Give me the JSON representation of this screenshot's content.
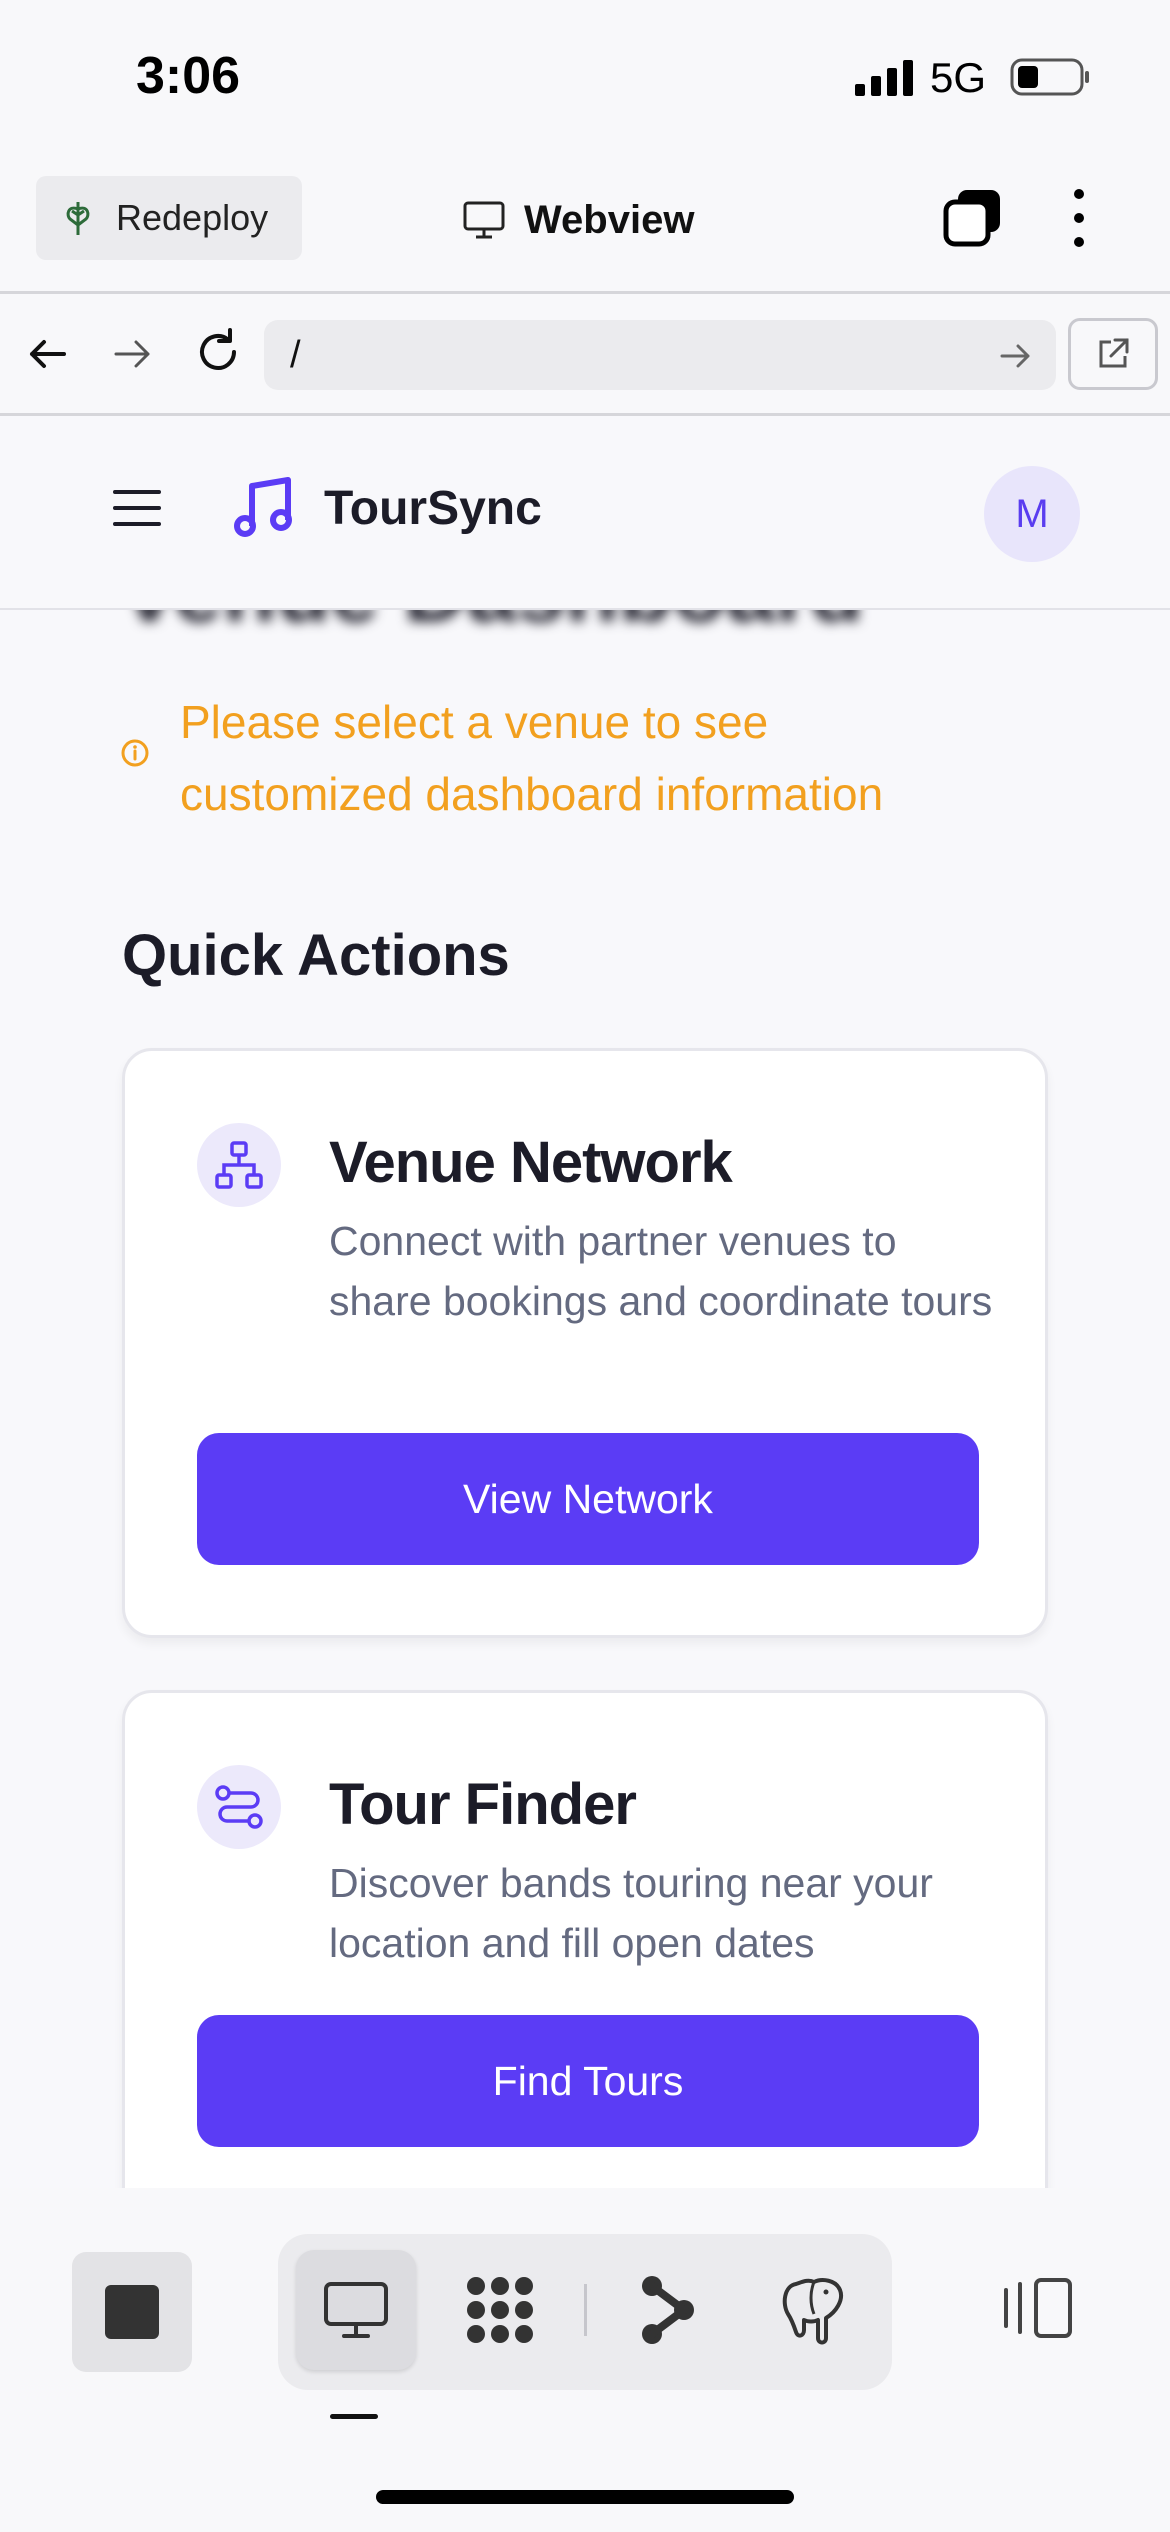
{
  "status_bar": {
    "time": "3:06",
    "network": "5G"
  },
  "toolbar": {
    "redeploy_label": "Redeploy",
    "title": "Webview"
  },
  "nav": {
    "url_value": "/"
  },
  "header": {
    "brand_name": "TourSync",
    "avatar_initial": "M"
  },
  "main": {
    "page_title": "Venue Dashboard",
    "alert_text": "Please select a venue to see customized dashboard information",
    "section_title": "Quick Actions",
    "cards": [
      {
        "title": "Venue Network",
        "description": "Connect with partner venues to share bookings and coordinate tours",
        "button_label": "View Network",
        "icon": "network-icon"
      },
      {
        "title": "Tour Finder",
        "description": "Discover bands touring near your location and fill open dates",
        "button_label": "Find Tours",
        "icon": "route-icon"
      }
    ]
  },
  "colors": {
    "accent": "#5b3cf5",
    "alert": "#f2a01f",
    "icon_bg": "#ece9fb"
  }
}
